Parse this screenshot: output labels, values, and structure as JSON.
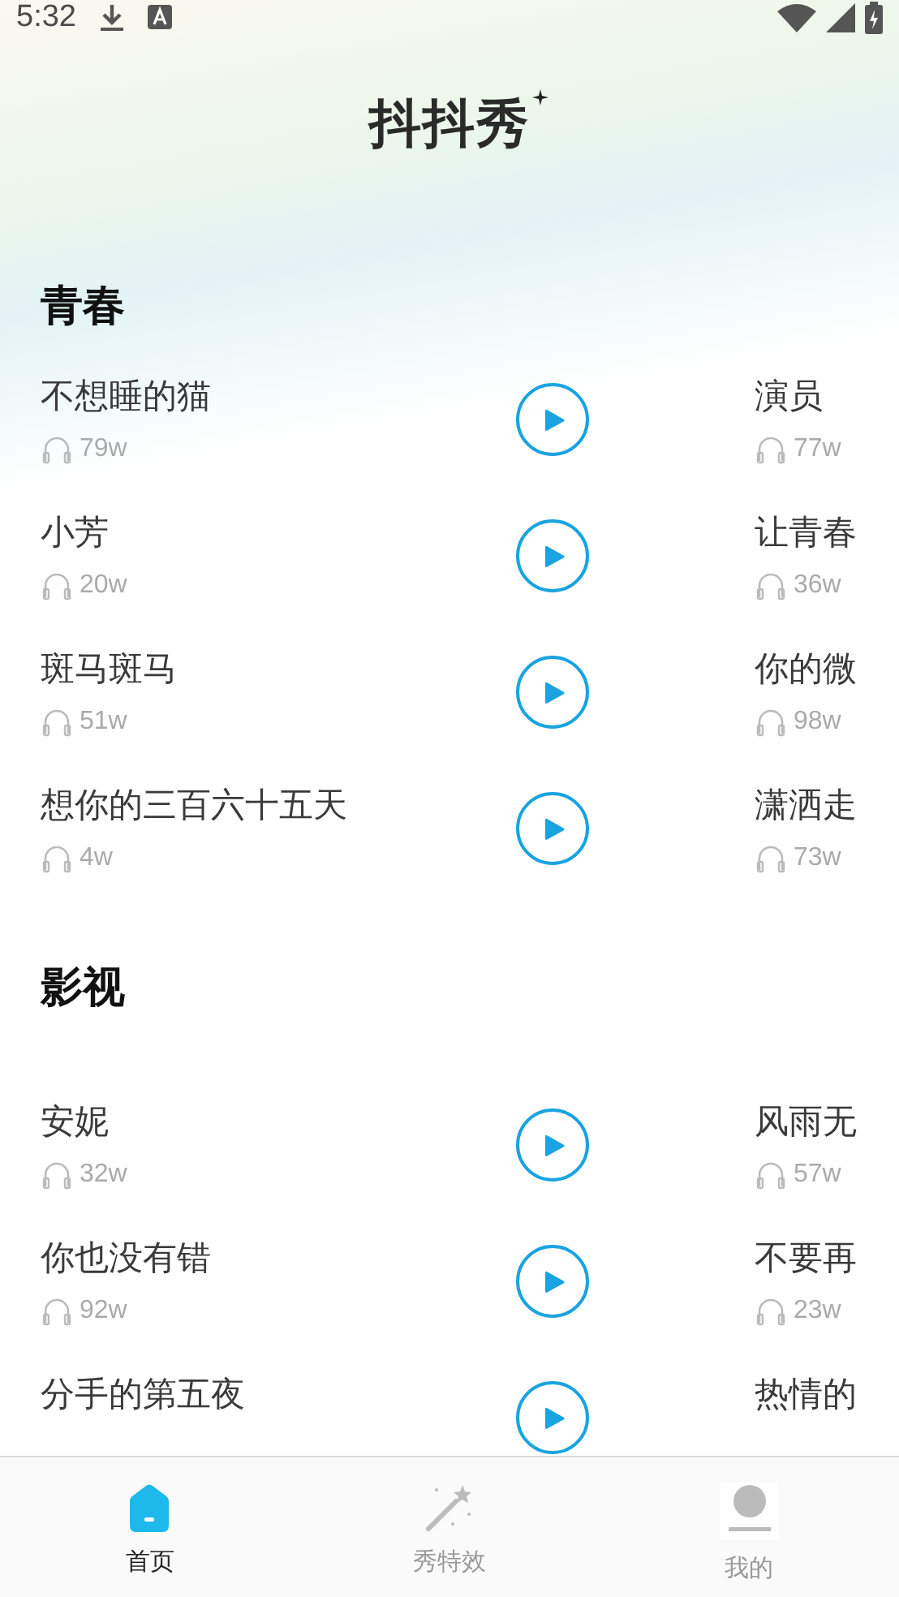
{
  "status_bar": {
    "time": "5:32"
  },
  "app_title": "抖抖秀",
  "sections": [
    {
      "title": "青春",
      "rows": [
        {
          "left": {
            "name": "不想睡的猫",
            "plays": "79w"
          },
          "right": {
            "name": "演员",
            "plays": "77w"
          }
        },
        {
          "left": {
            "name": "小芳",
            "plays": "20w"
          },
          "right": {
            "name": "让青春",
            "plays": "36w"
          }
        },
        {
          "left": {
            "name": "斑马斑马",
            "plays": "51w"
          },
          "right": {
            "name": "你的微",
            "plays": "98w"
          }
        },
        {
          "left": {
            "name": "想你的三百六十五天",
            "plays": "4w"
          },
          "right": {
            "name": "潇洒走",
            "plays": "73w"
          }
        }
      ]
    },
    {
      "title": "影视",
      "rows": [
        {
          "left": {
            "name": "安妮",
            "plays": "32w"
          },
          "right": {
            "name": "风雨无",
            "plays": "57w"
          }
        },
        {
          "left": {
            "name": "你也没有错",
            "plays": "92w"
          },
          "right": {
            "name": "不要再",
            "plays": "23w"
          }
        },
        {
          "left": {
            "name": "分手的第五夜"
          },
          "right": {
            "name": "热情的"
          }
        }
      ]
    }
  ],
  "tabs": [
    {
      "label": "首页",
      "kind": "home",
      "selected": true
    },
    {
      "label": "秀特效",
      "kind": "effects",
      "selected": false
    },
    {
      "label": "我的",
      "kind": "profile",
      "selected": false
    }
  ]
}
